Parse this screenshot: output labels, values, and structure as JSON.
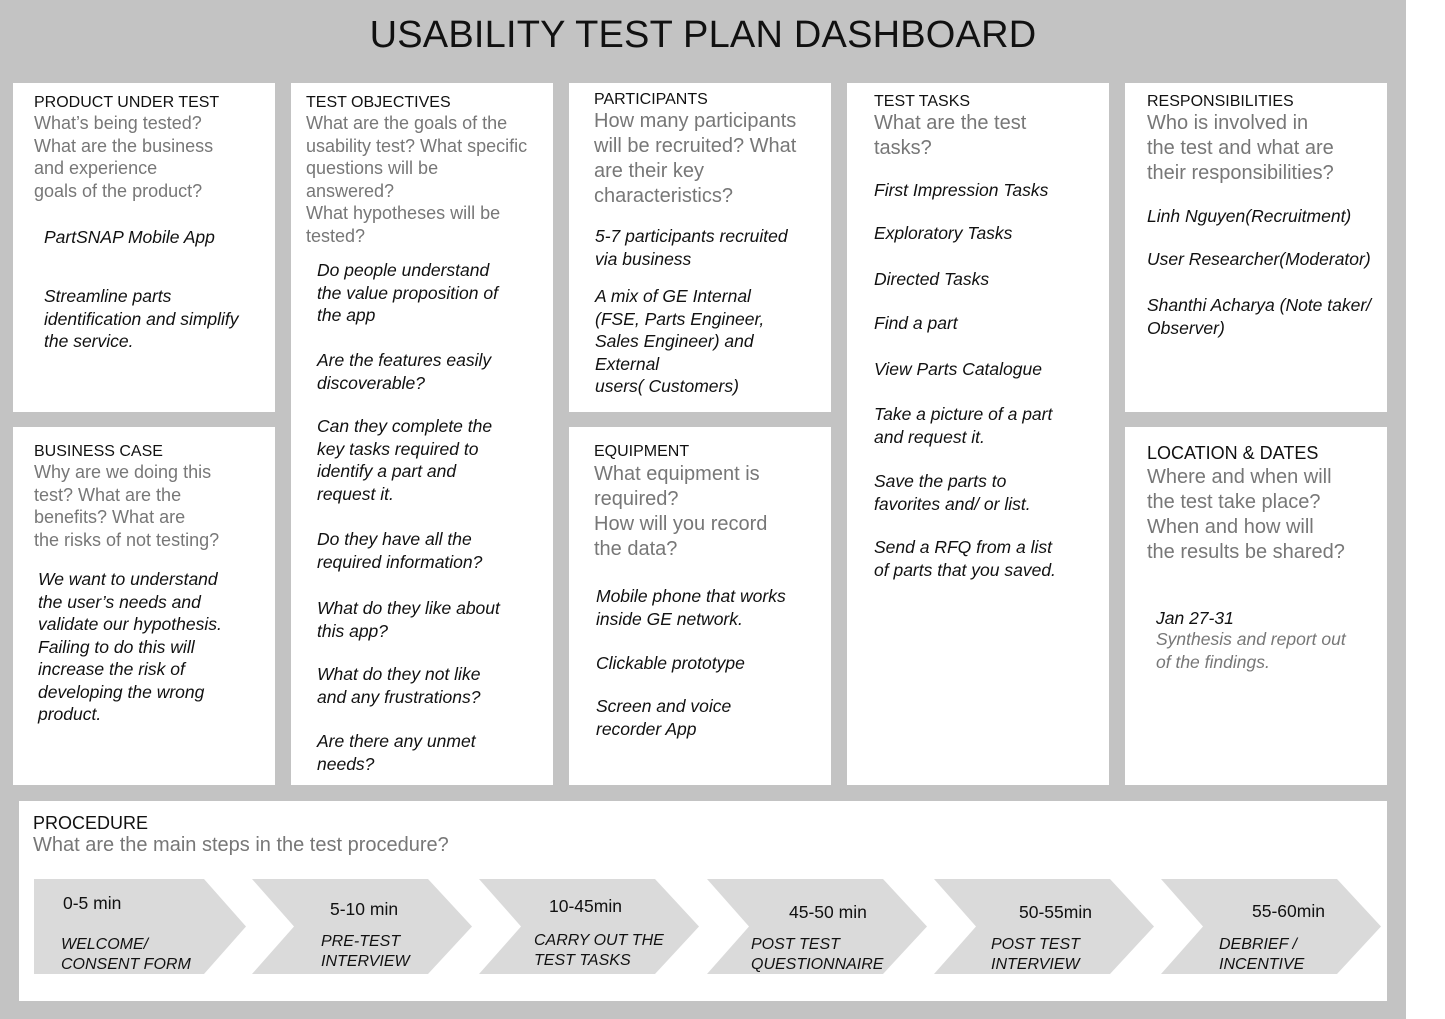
{
  "title": "USABILITY TEST PLAN DASHBOARD",
  "product": {
    "heading": "PRODUCT UNDER TEST",
    "prompt": [
      "What’s being tested?",
      "What are the business",
      "and experience",
      "goals of the product?"
    ],
    "answer1": "PartSNAP Mobile App",
    "answer2": [
      "Streamline parts",
      "identification and simplify",
      "the service."
    ]
  },
  "business_case": {
    "heading": "BUSINESS CASE",
    "prompt": [
      "Why are we doing this",
      "test? What are the",
      "benefits? What are",
      "the risks of not testing?"
    ],
    "answer": [
      "We want to understand",
      "the user’s needs and",
      "validate our hypothesis.",
      "Failing to do this will",
      "increase the risk of",
      "developing the wrong",
      "product."
    ]
  },
  "objectives": {
    "heading": "TEST OBJECTIVES",
    "prompt": [
      "What are the goals of the",
      "usability test? What specific",
      "questions will be",
      "answered?",
      "What hypotheses will be",
      "tested?"
    ],
    "items": [
      [
        "Do people understand",
        "the value proposition of",
        "the app"
      ],
      [
        "Are the features easily",
        "discoverable?"
      ],
      [
        "Can they complete the",
        "key tasks required to",
        "identify a part and",
        "request it."
      ],
      [
        "Do they have all the",
        "required information?"
      ],
      [
        "What do they like about",
        "this app?"
      ],
      [
        "What do they not like",
        "and any frustrations?"
      ],
      [
        "Are there any unmet",
        "needs?"
      ]
    ]
  },
  "participants": {
    "heading": "PARTICIPANTS",
    "prompt": [
      "How many participants",
      "will be recruited? What",
      "are their key",
      "characteristics?"
    ],
    "answer1": [
      "5-7 participants recruited",
      "via business"
    ],
    "answer2": [
      "A mix of GE Internal",
      "(FSE, Parts Engineer,",
      "Sales Engineer) and",
      "External",
      "users( Customers)"
    ]
  },
  "equipment": {
    "heading": "EQUIPMENT",
    "prompt": [
      "What equipment is",
      "required?",
      "How will you record",
      "the data?"
    ],
    "items": [
      [
        "Mobile phone that works",
        "inside GE network."
      ],
      [
        "Clickable prototype"
      ],
      [
        "Screen and voice",
        "recorder App"
      ]
    ]
  },
  "tasks": {
    "heading": "TEST TASKS",
    "prompt": [
      "What are the test",
      "tasks?"
    ],
    "items": [
      [
        "First Impression Tasks"
      ],
      [
        "Exploratory Tasks"
      ],
      [
        "Directed Tasks"
      ],
      [
        "Find a part"
      ],
      [
        "View Parts Catalogue"
      ],
      [
        "Take a picture of a part",
        "and request it."
      ],
      [
        "Save the parts to",
        "favorites and/ or list."
      ],
      [
        "Send a RFQ from a list",
        "of parts that you saved."
      ]
    ]
  },
  "responsibilities": {
    "heading": "RESPONSIBILITIES",
    "prompt": [
      "Who is involved in",
      "the test and what are",
      "their responsibilities?"
    ],
    "items": [
      [
        "Linh Nguyen(Recruitment)"
      ],
      [
        "User Researcher(Moderator)"
      ],
      [
        "Shanthi Acharya  (Note taker/",
        "Observer)"
      ]
    ]
  },
  "location": {
    "heading": "LOCATION & DATES",
    "prompt": [
      "Where and when will",
      "the test take place?",
      "When and how will",
      "the results be shared?"
    ],
    "date": "Jan 27-31",
    "note": [
      "Synthesis and report out",
      "of the findings."
    ]
  },
  "procedure": {
    "heading": "PROCEDURE",
    "prompt": "What are the main steps in the test procedure?",
    "steps": [
      {
        "time": "0-5 min",
        "label": [
          "WELCOME/",
          "CONSENT FORM"
        ]
      },
      {
        "time": "5-10 min",
        "label": [
          "PRE-TEST",
          "INTERVIEW"
        ]
      },
      {
        "time": "10-45min",
        "label": [
          "CARRY OUT THE",
          "TEST TASKS"
        ]
      },
      {
        "time": "45-50 min",
        "label": [
          "POST TEST",
          "QUESTIONNAIRE"
        ]
      },
      {
        "time": "50-55min",
        "label": [
          "POST TEST",
          "INTERVIEW"
        ]
      },
      {
        "time": "55-60min",
        "label": [
          "DEBRIEF /",
          "INCENTIVE"
        ]
      }
    ]
  },
  "colors": {
    "board": "#c3c3c3",
    "card": "#ffffff",
    "chevron": "#dadada",
    "prompt": "#777777"
  }
}
